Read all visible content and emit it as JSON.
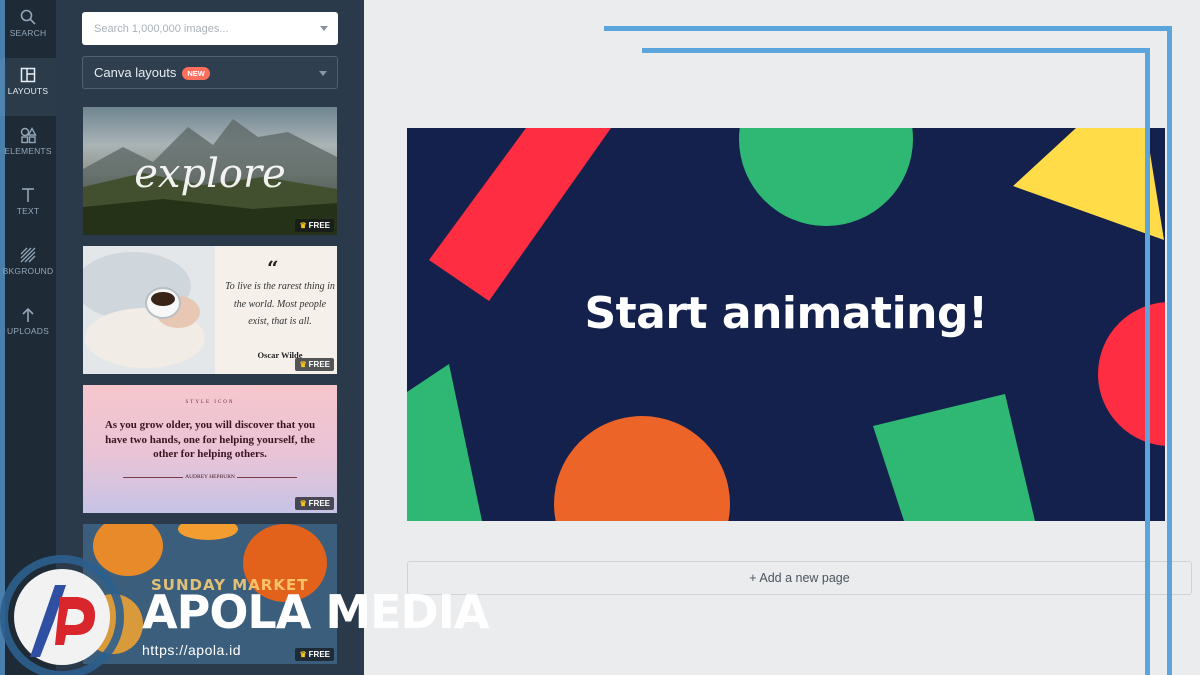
{
  "sidebar": {
    "items": [
      {
        "label": "SEARCH",
        "icon": "search-icon"
      },
      {
        "label": "LAYOUTS",
        "icon": "layouts-icon"
      },
      {
        "label": "ELEMENTS",
        "icon": "elements-icon"
      },
      {
        "label": "TEXT",
        "icon": "text-icon"
      },
      {
        "label": "BKGROUND",
        "icon": "background-icon"
      },
      {
        "label": "UPLOADS",
        "icon": "upload-icon"
      }
    ],
    "active": "LAYOUTS"
  },
  "panel": {
    "search_placeholder": "Search 1,000,000 images...",
    "layout_select": "Canva layouts",
    "layout_badge": "NEW",
    "free_label": "FREE",
    "templates": [
      {
        "name": "explore",
        "text": "explore"
      },
      {
        "name": "oscar-wilde-quote",
        "quote_mark": "“",
        "text": "To live is the rarest thing in the world. Most people exist, that is all.",
        "author": "Oscar Wilde"
      },
      {
        "name": "audrey-hepburn-quote",
        "kicker": "STYLE ICON",
        "text": "As you grow older, you will discover that you have two hands, one for helping yourself, the other for helping others.",
        "author": "AUDREY HEPBURN"
      },
      {
        "name": "sunday-market",
        "text": "SUNDAY MARKET"
      }
    ]
  },
  "canvas": {
    "headline": "Start animating!",
    "background": "#14214d"
  },
  "editor": {
    "add_page_label": "+ Add a new page"
  },
  "watermark": {
    "brand": "APOLA MEDIA",
    "url": "https://apola.id"
  },
  "colors": {
    "rail": "#1e2a36",
    "panel": "#2a3a4a",
    "frame_accent": "#5ba4dc",
    "shape_red": "#ff2d41",
    "shape_green": "#2fb873",
    "shape_yellow": "#ffdc48",
    "shape_orange": "#ec6428"
  }
}
